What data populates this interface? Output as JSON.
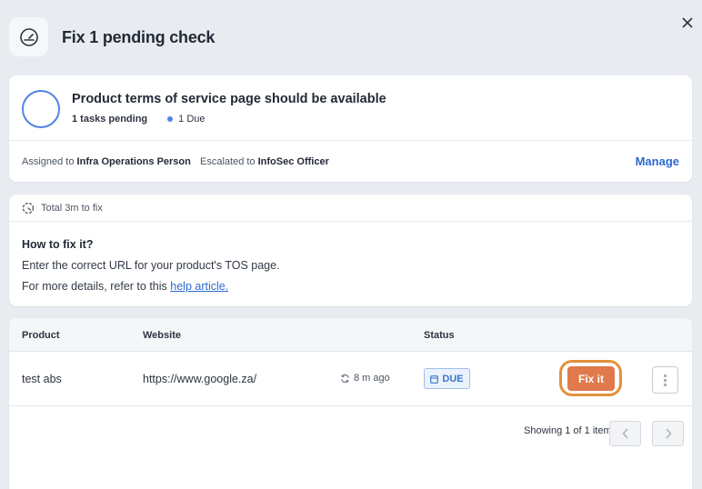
{
  "header": {
    "title": "Fix 1 pending check",
    "icon": "gauge-icon",
    "close_icon": "close-icon"
  },
  "check": {
    "title": "Product terms of service page should be available",
    "tasks_pending": "1 tasks pending",
    "due": "1 Due",
    "assigned_label": "Assigned to",
    "assigned_value": "Infra Operations Person",
    "escalated_label": "Escalated to",
    "escalated_value": "InfoSec Officer",
    "manage_label": "Manage",
    "accent": "#4f84e0"
  },
  "fix": {
    "time_label": "Total 3m to fix",
    "heading": "How to fix it?",
    "line1": "Enter the correct URL for your product's TOS page.",
    "line2_prefix": "For more details, refer to this",
    "help_link": "help article."
  },
  "table": {
    "headers": {
      "product": "Product",
      "website": "Website",
      "status": "Status"
    },
    "rows": [
      {
        "product": "test abs",
        "website": "https://www.google.za/",
        "updated": "8 m ago",
        "status": "DUE",
        "action": "Fix it"
      }
    ],
    "pagination": "Showing 1 of 1 items"
  },
  "colors": {
    "fix_button": "#e07a4c",
    "highlight_ring": "#e3903b",
    "link": "#2d6ad1"
  }
}
